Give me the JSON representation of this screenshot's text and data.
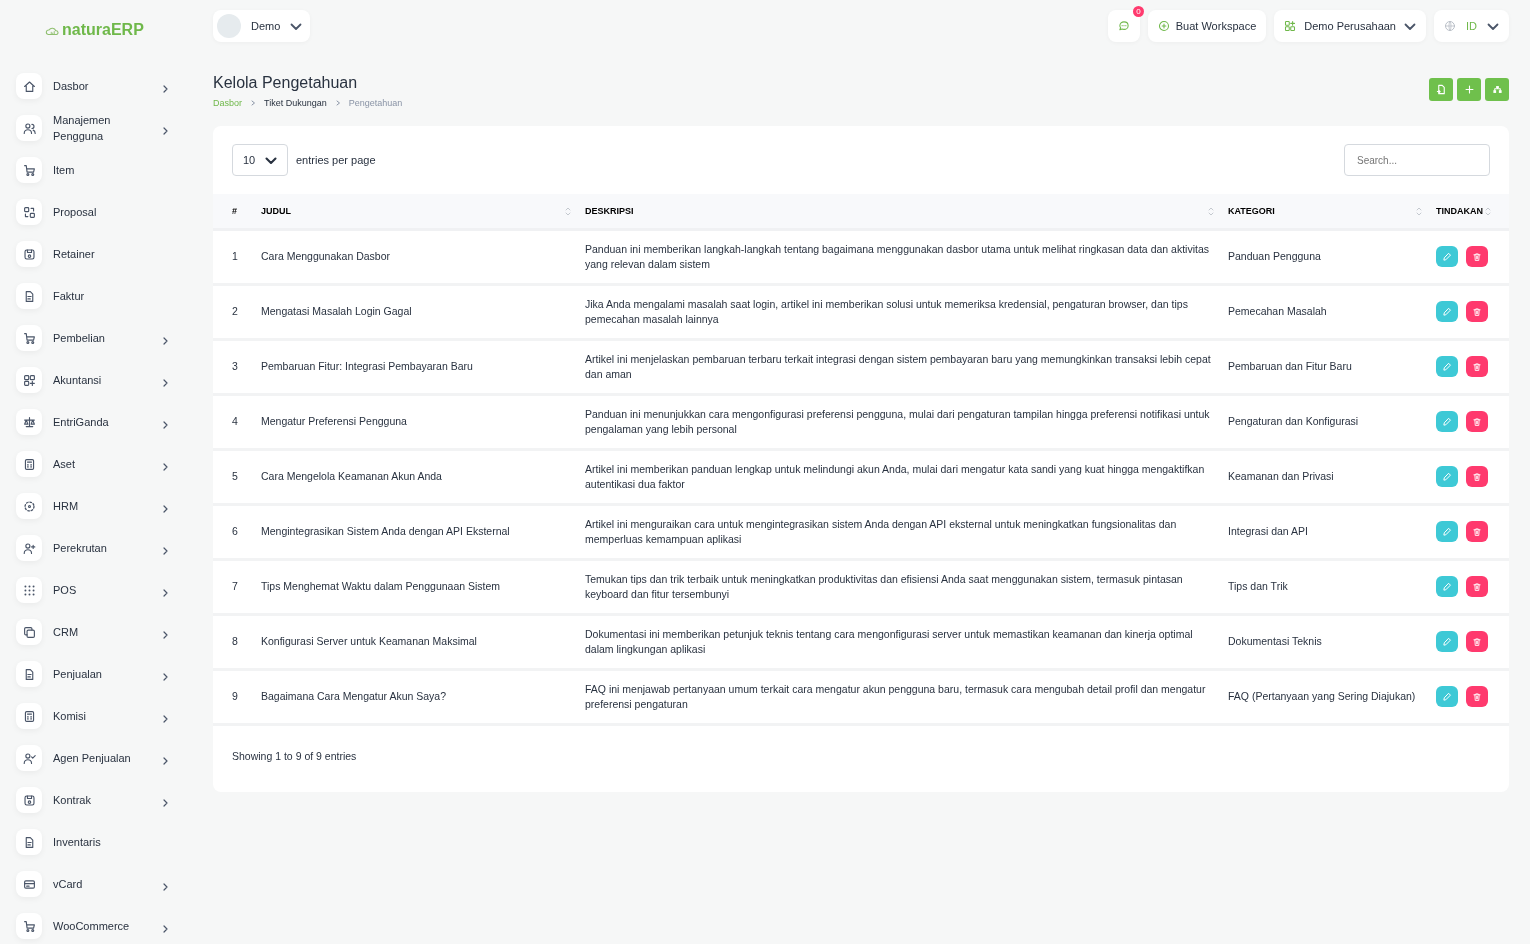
{
  "brand": {
    "name": "naturaERP"
  },
  "user_menu": {
    "label": "Demo"
  },
  "topbar": {
    "chat_count": "0",
    "create_workspace": "Buat Workspace",
    "company": "Demo Perusahaan",
    "language": "ID"
  },
  "sidebar": {
    "items": [
      {
        "label": "Dasbor",
        "expandable": true
      },
      {
        "label": "Manajemen Pengguna",
        "expandable": true
      },
      {
        "label": "Item",
        "expandable": false
      },
      {
        "label": "Proposal",
        "expandable": false
      },
      {
        "label": "Retainer",
        "expandable": false
      },
      {
        "label": "Faktur",
        "expandable": false
      },
      {
        "label": "Pembelian",
        "expandable": true
      },
      {
        "label": "Akuntansi",
        "expandable": true
      },
      {
        "label": "EntriGanda",
        "expandable": true
      },
      {
        "label": "Aset",
        "expandable": true
      },
      {
        "label": "HRM",
        "expandable": true
      },
      {
        "label": "Perekrutan",
        "expandable": true
      },
      {
        "label": "POS",
        "expandable": true
      },
      {
        "label": "CRM",
        "expandable": true
      },
      {
        "label": "Penjualan",
        "expandable": true
      },
      {
        "label": "Komisi",
        "expandable": true
      },
      {
        "label": "Agen Penjualan",
        "expandable": true
      },
      {
        "label": "Kontrak",
        "expandable": true
      },
      {
        "label": "Inventaris",
        "expandable": false
      },
      {
        "label": "vCard",
        "expandable": true
      },
      {
        "label": "WooCommerce",
        "expandable": true
      }
    ]
  },
  "page": {
    "title": "Kelola Pengetahuan",
    "breadcrumb": [
      "Dasbor",
      "Tiket Dukungan",
      "Pengetahuan"
    ]
  },
  "table": {
    "page_size": "10",
    "page_size_label": "entries per page",
    "search_placeholder": "Search...",
    "columns": [
      "#",
      "JUDUL",
      "DESKRIPSI",
      "KATEGORI",
      "TINDAKAN"
    ],
    "rows": [
      {
        "no": "1",
        "title": "Cara Menggunakan Dasbor",
        "description": "Panduan ini memberikan langkah-langkah tentang bagaimana menggunakan dasbor utama untuk melihat ringkasan data dan aktivitas yang relevan dalam sistem",
        "category": "Panduan Pengguna"
      },
      {
        "no": "2",
        "title": "Mengatasi Masalah Login Gagal",
        "description": "Jika Anda mengalami masalah saat login, artikel ini memberikan solusi untuk memeriksa kredensial, pengaturan browser, dan tips pemecahan masalah lainnya",
        "category": "Pemecahan Masalah"
      },
      {
        "no": "3",
        "title": "Pembaruan Fitur: Integrasi Pembayaran Baru",
        "description": "Artikel ini menjelaskan pembaruan terbaru terkait integrasi dengan sistem pembayaran baru yang memungkinkan transaksi lebih cepat dan aman",
        "category": "Pembaruan dan Fitur Baru"
      },
      {
        "no": "4",
        "title": "Mengatur Preferensi Pengguna",
        "description": "Panduan ini menunjukkan cara mengonfigurasi preferensi pengguna, mulai dari pengaturan tampilan hingga preferensi notifikasi untuk pengalaman yang lebih personal",
        "category": "Pengaturan dan Konfigurasi"
      },
      {
        "no": "5",
        "title": "Cara Mengelola Keamanan Akun Anda",
        "description": "Artikel ini memberikan panduan lengkap untuk melindungi akun Anda, mulai dari mengatur kata sandi yang kuat hingga mengaktifkan autentikasi dua faktor",
        "category": "Keamanan dan Privasi"
      },
      {
        "no": "6",
        "title": "Mengintegrasikan Sistem Anda dengan API Eksternal",
        "description": "Artikel ini menguraikan cara untuk mengintegrasikan sistem Anda dengan API eksternal untuk meningkatkan fungsionalitas dan memperluas kemampuan aplikasi",
        "category": "Integrasi dan API"
      },
      {
        "no": "7",
        "title": "Tips Menghemat Waktu dalam Penggunaan Sistem",
        "description": "Temukan tips dan trik terbaik untuk meningkatkan produktivitas dan efisiensi Anda saat menggunakan sistem, termasuk pintasan keyboard dan fitur tersembunyi",
        "category": "Tips dan Trik"
      },
      {
        "no": "8",
        "title": "Konfigurasi Server untuk Keamanan Maksimal",
        "description": "Dokumentasi ini memberikan petunjuk teknis tentang cara mengonfigurasi server untuk memastikan keamanan dan kinerja optimal dalam lingkungan aplikasi",
        "category": "Dokumentasi Teknis"
      },
      {
        "no": "9",
        "title": "Bagaimana Cara Mengatur Akun Saya?",
        "description": "FAQ ini menjawab pertanyaan umum terkait cara mengatur akun pengguna baru, termasuk cara mengubah detail profil dan mengatur preferensi pengaturan",
        "category": "FAQ (Pertanyaan yang Sering Diajukan)"
      }
    ],
    "footer": "Showing 1 to 9 of 9 entries"
  }
}
